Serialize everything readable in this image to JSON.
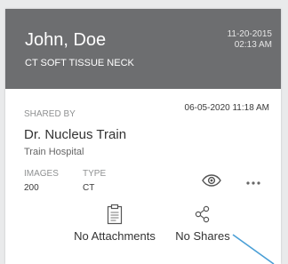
{
  "card": {
    "patient_name": "John, Doe",
    "study_description": "CT SOFT TISSUE NECK",
    "study_date": "11-20-2015",
    "study_time": "02:13 AM",
    "shared_by_label": "SHARED BY",
    "shared_datetime": "06-05-2020 11:18 AM",
    "shared_by_name": "Dr. Nucleus Train",
    "shared_by_org": "Train Hospital",
    "images_label": "IMAGES",
    "images_count": "200",
    "type_label": "TYPE",
    "type_value": "CT",
    "attachments_label": "No Attachments",
    "shares_label": "No Shares"
  },
  "icons": {
    "view": "eye-icon",
    "more": "more-horizontal-icon",
    "attachments": "clipboard-icon",
    "shares": "share-icon"
  },
  "colors": {
    "page_background": "#e9eaeb",
    "header_background": "#6d6e70",
    "header_text": "#ffffff",
    "label_gray": "#8f9192",
    "body_text": "#333333",
    "overlay_line": "#4a9fd6"
  }
}
